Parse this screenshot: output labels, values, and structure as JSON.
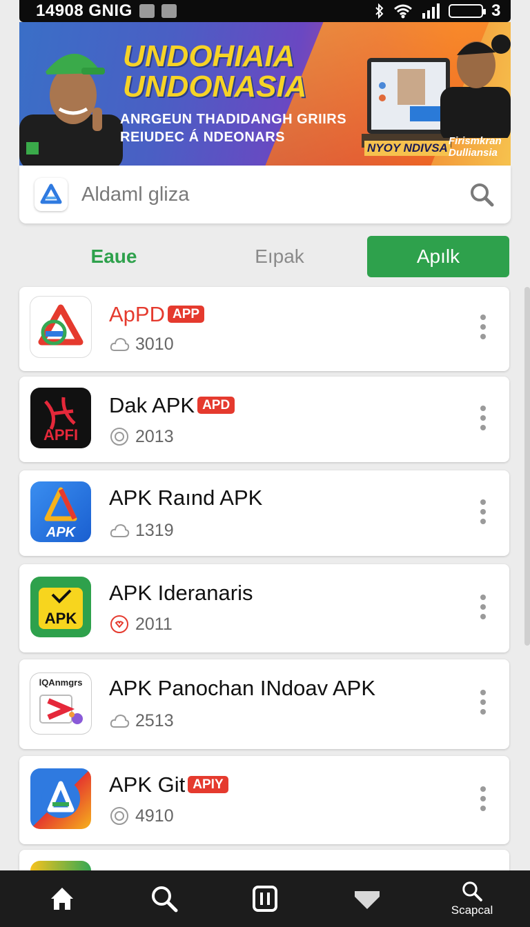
{
  "status_bar": {
    "left_text": "14908 GNIG",
    "right_text": "3"
  },
  "banner": {
    "title_line1": "UNDOHIAIA",
    "title_line2": "UNDONASIA",
    "sub_line1": "ANRGEUN THADIDANGH GRIIRS",
    "sub_line2": "REIUDEC Á NDEONARS",
    "tag_left": "NYOY NDIVSA",
    "tag_right_line1": "Firismkran",
    "tag_right_line2": "Dulliansia"
  },
  "search": {
    "placeholder": "Aldaml gliza"
  },
  "tabs": [
    {
      "label": "Eaue",
      "state": "active-text"
    },
    {
      "label": "Eıpak",
      "state": "inactive"
    },
    {
      "label": "Apılk",
      "state": "selected"
    }
  ],
  "apps": [
    {
      "name": "ApPD",
      "badge": "APP",
      "count": "3010",
      "meta_icon": "cloud-icon",
      "name_color": "#e53a2e"
    },
    {
      "name": "Dak APK",
      "badge": "APD",
      "count": "2013",
      "meta_icon": "download-ring-icon",
      "icon_text": "APFI"
    },
    {
      "name": "APK Raınd APK",
      "badge": "",
      "count": "1319",
      "meta_icon": "cloud-icon",
      "icon_text": "APK"
    },
    {
      "name": "APK Ideranaris",
      "badge": "",
      "count": "2011",
      "meta_icon": "heart-ring-icon",
      "icon_text": "APK"
    },
    {
      "name": "APK Panochan INdoav APK",
      "badge": "",
      "count": "2513",
      "meta_icon": "cloud-icon",
      "icon_text": "lQAnmgrs"
    },
    {
      "name": "APK Git",
      "badge": "APIY",
      "count": "4910",
      "meta_icon": "download-ring-icon"
    }
  ],
  "bottom_nav": [
    {
      "icon": "home-icon",
      "label": ""
    },
    {
      "icon": "search-icon",
      "label": ""
    },
    {
      "icon": "pause-icon",
      "label": ""
    },
    {
      "icon": "heart-icon",
      "label": ""
    },
    {
      "icon": "search-icon",
      "label": "Scapcal"
    }
  ],
  "colors": {
    "accent_green": "#2ea14c",
    "badge_red": "#e53a2e",
    "nav_bg": "#1c1c1c"
  }
}
